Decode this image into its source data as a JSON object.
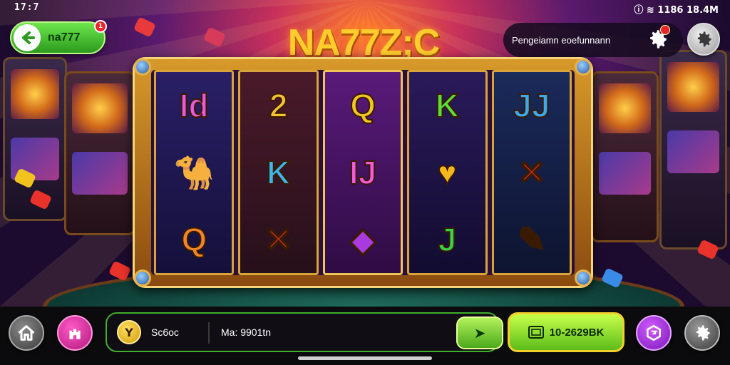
{
  "status_bar": {
    "time_left": "17:7",
    "right_text": "ⓘ ≋ 1186 18.4M"
  },
  "back_button": {
    "label": "na777",
    "badge": "1"
  },
  "title": "NA77Z;C",
  "promo": {
    "text": "Pengeiamn eoefunnann"
  },
  "reels": [
    {
      "symbols": [
        {
          "text": "Id",
          "color": "#e95ad8"
        },
        {
          "text": "🐪",
          "color": "#e8c23a"
        },
        {
          "text": "Q",
          "color": "#f0862a"
        }
      ]
    },
    {
      "symbols": [
        {
          "text": "2",
          "color": "#f6c330"
        },
        {
          "text": "K",
          "color": "#3ab8f0"
        },
        {
          "text": "✕",
          "color": "#e8322a"
        }
      ]
    },
    {
      "symbols": [
        {
          "text": "Q",
          "color": "#f2c61e"
        },
        {
          "text": "IJ",
          "color": "#f25ad8"
        },
        {
          "text": "◆",
          "color": "#a83ae0"
        }
      ]
    },
    {
      "symbols": [
        {
          "text": "K",
          "color": "#5ae03a"
        },
        {
          "text": "♥",
          "color": "#f2b81e"
        },
        {
          "text": "J",
          "color": "#3ad04a"
        }
      ]
    },
    {
      "symbols": [
        {
          "text": "JJ",
          "color": "#3aaaf0"
        },
        {
          "text": "✕",
          "color": "#e8322a"
        },
        {
          "text": "✎",
          "color": "#f24a8a"
        }
      ]
    }
  ],
  "bottom": {
    "coin_symbol": "Y",
    "coin_label": "Sc6oc",
    "bet_label": "Ma: 9901tn",
    "spin_symbol": "➤",
    "balance_value": "10-2629BK"
  }
}
